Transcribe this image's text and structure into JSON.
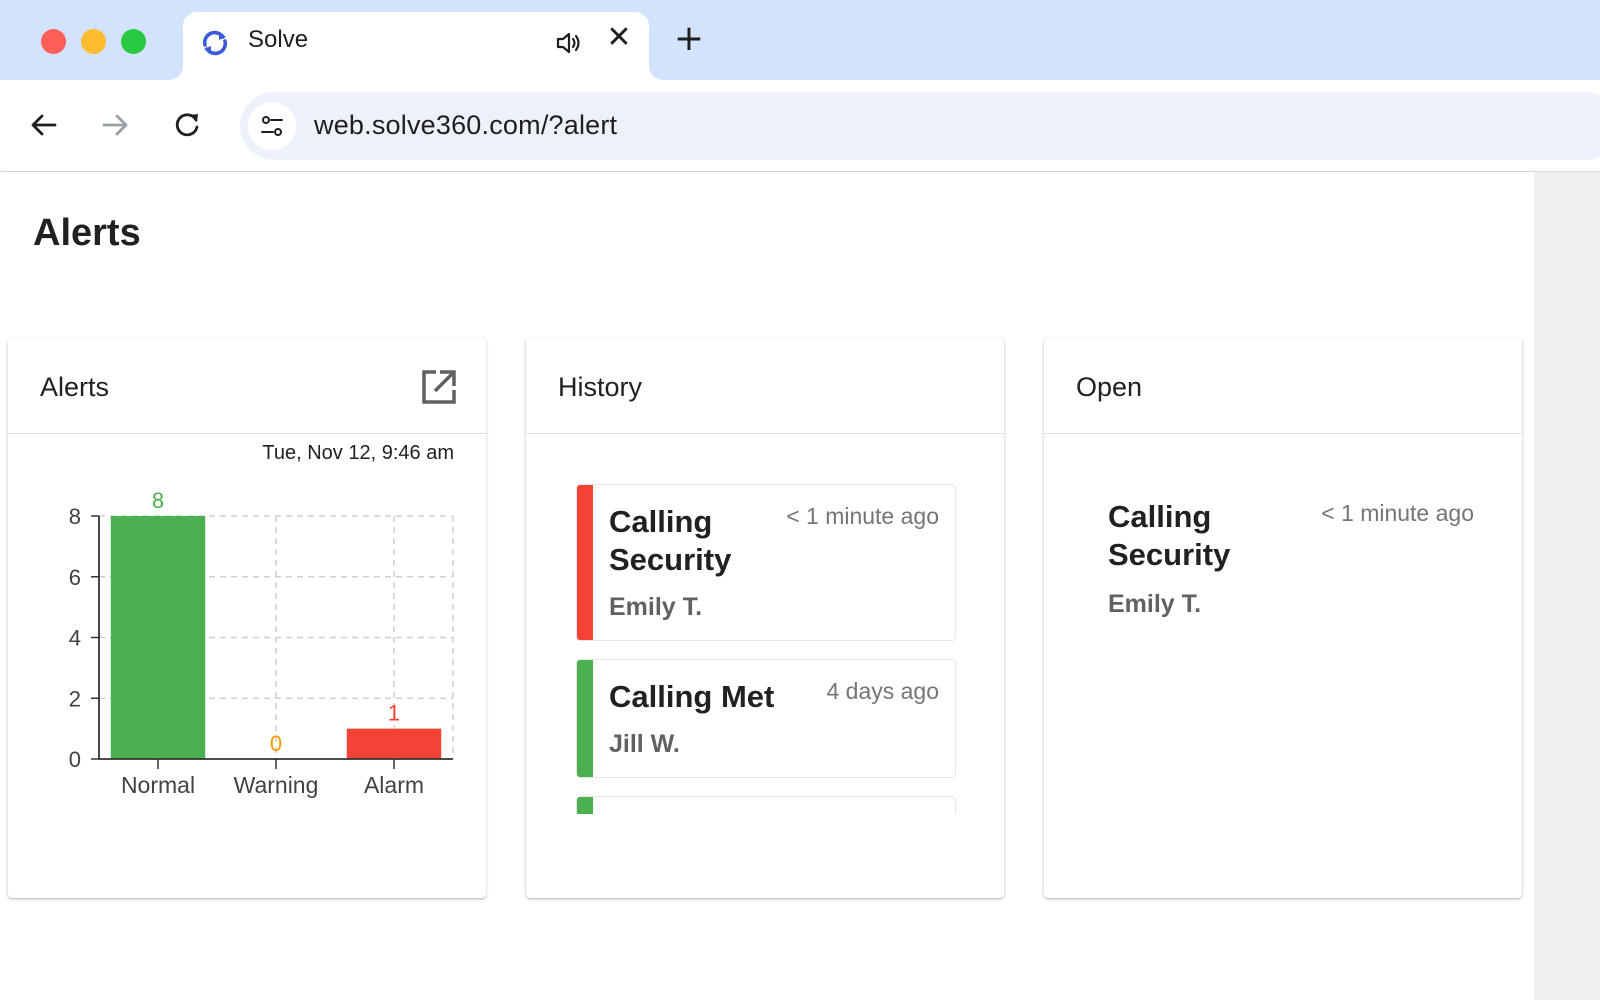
{
  "browser": {
    "tab_title": "Solve",
    "url": "web.solve360.com/?alert"
  },
  "page": {
    "title": "Alerts"
  },
  "cards": {
    "alerts": {
      "title": "Alerts",
      "timestamp": "Tue, Nov 12, 9:46 am"
    },
    "history": {
      "title": "History",
      "items": [
        {
          "title": "Calling Security",
          "time": "< 1 minute ago",
          "name": "Emily T.",
          "status_color": "#f44336"
        },
        {
          "title": "Calling Met",
          "time": "4 days ago",
          "name": "Jill W.",
          "status_color": "#4caf50"
        },
        {
          "title": "",
          "time": "",
          "name": "",
          "status_color": "#4caf50"
        }
      ]
    },
    "open": {
      "title": "Open",
      "item": {
        "title": "Calling Security",
        "time": "< 1 minute ago",
        "name": "Emily T."
      }
    }
  },
  "chart_data": {
    "type": "bar",
    "categories": [
      "Normal",
      "Warning",
      "Alarm"
    ],
    "values": [
      8,
      0,
      1
    ],
    "colors": [
      "#4caf50",
      "#ff9800",
      "#f44336"
    ],
    "ylim": [
      0,
      8
    ],
    "yticks": [
      0,
      2,
      4,
      6,
      8
    ],
    "grid": true
  },
  "colors": {
    "tabbar": "#d3e3fd",
    "normal": "#4caf50",
    "warning": "#ff9800",
    "alarm": "#f44336"
  }
}
